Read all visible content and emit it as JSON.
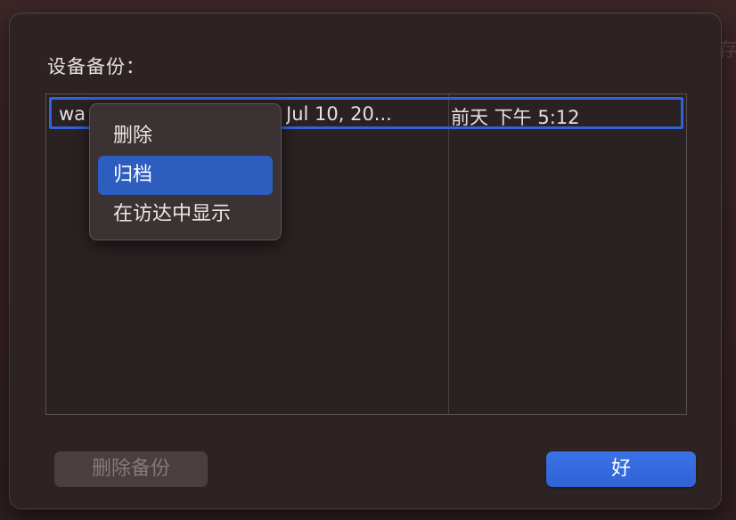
{
  "dialog": {
    "title": "设备备份：",
    "backups": [
      {
        "name": "wa",
        "date_created": "Jul 10, 20...",
        "last_backup": "前天 下午 5:12"
      }
    ],
    "delete_button_label": "删除备份",
    "ok_button_label": "好"
  },
  "context_menu": {
    "items": [
      {
        "label": "删除"
      },
      {
        "label": "归档",
        "selected": true
      },
      {
        "label": "在访达中显示"
      }
    ]
  },
  "background": {
    "ghost_text": "存"
  },
  "colors": {
    "accent": "#2f63d6",
    "dialog_bg": "#2d2323",
    "menu_bg": "#3b3233",
    "text": "#e6e0e0"
  }
}
